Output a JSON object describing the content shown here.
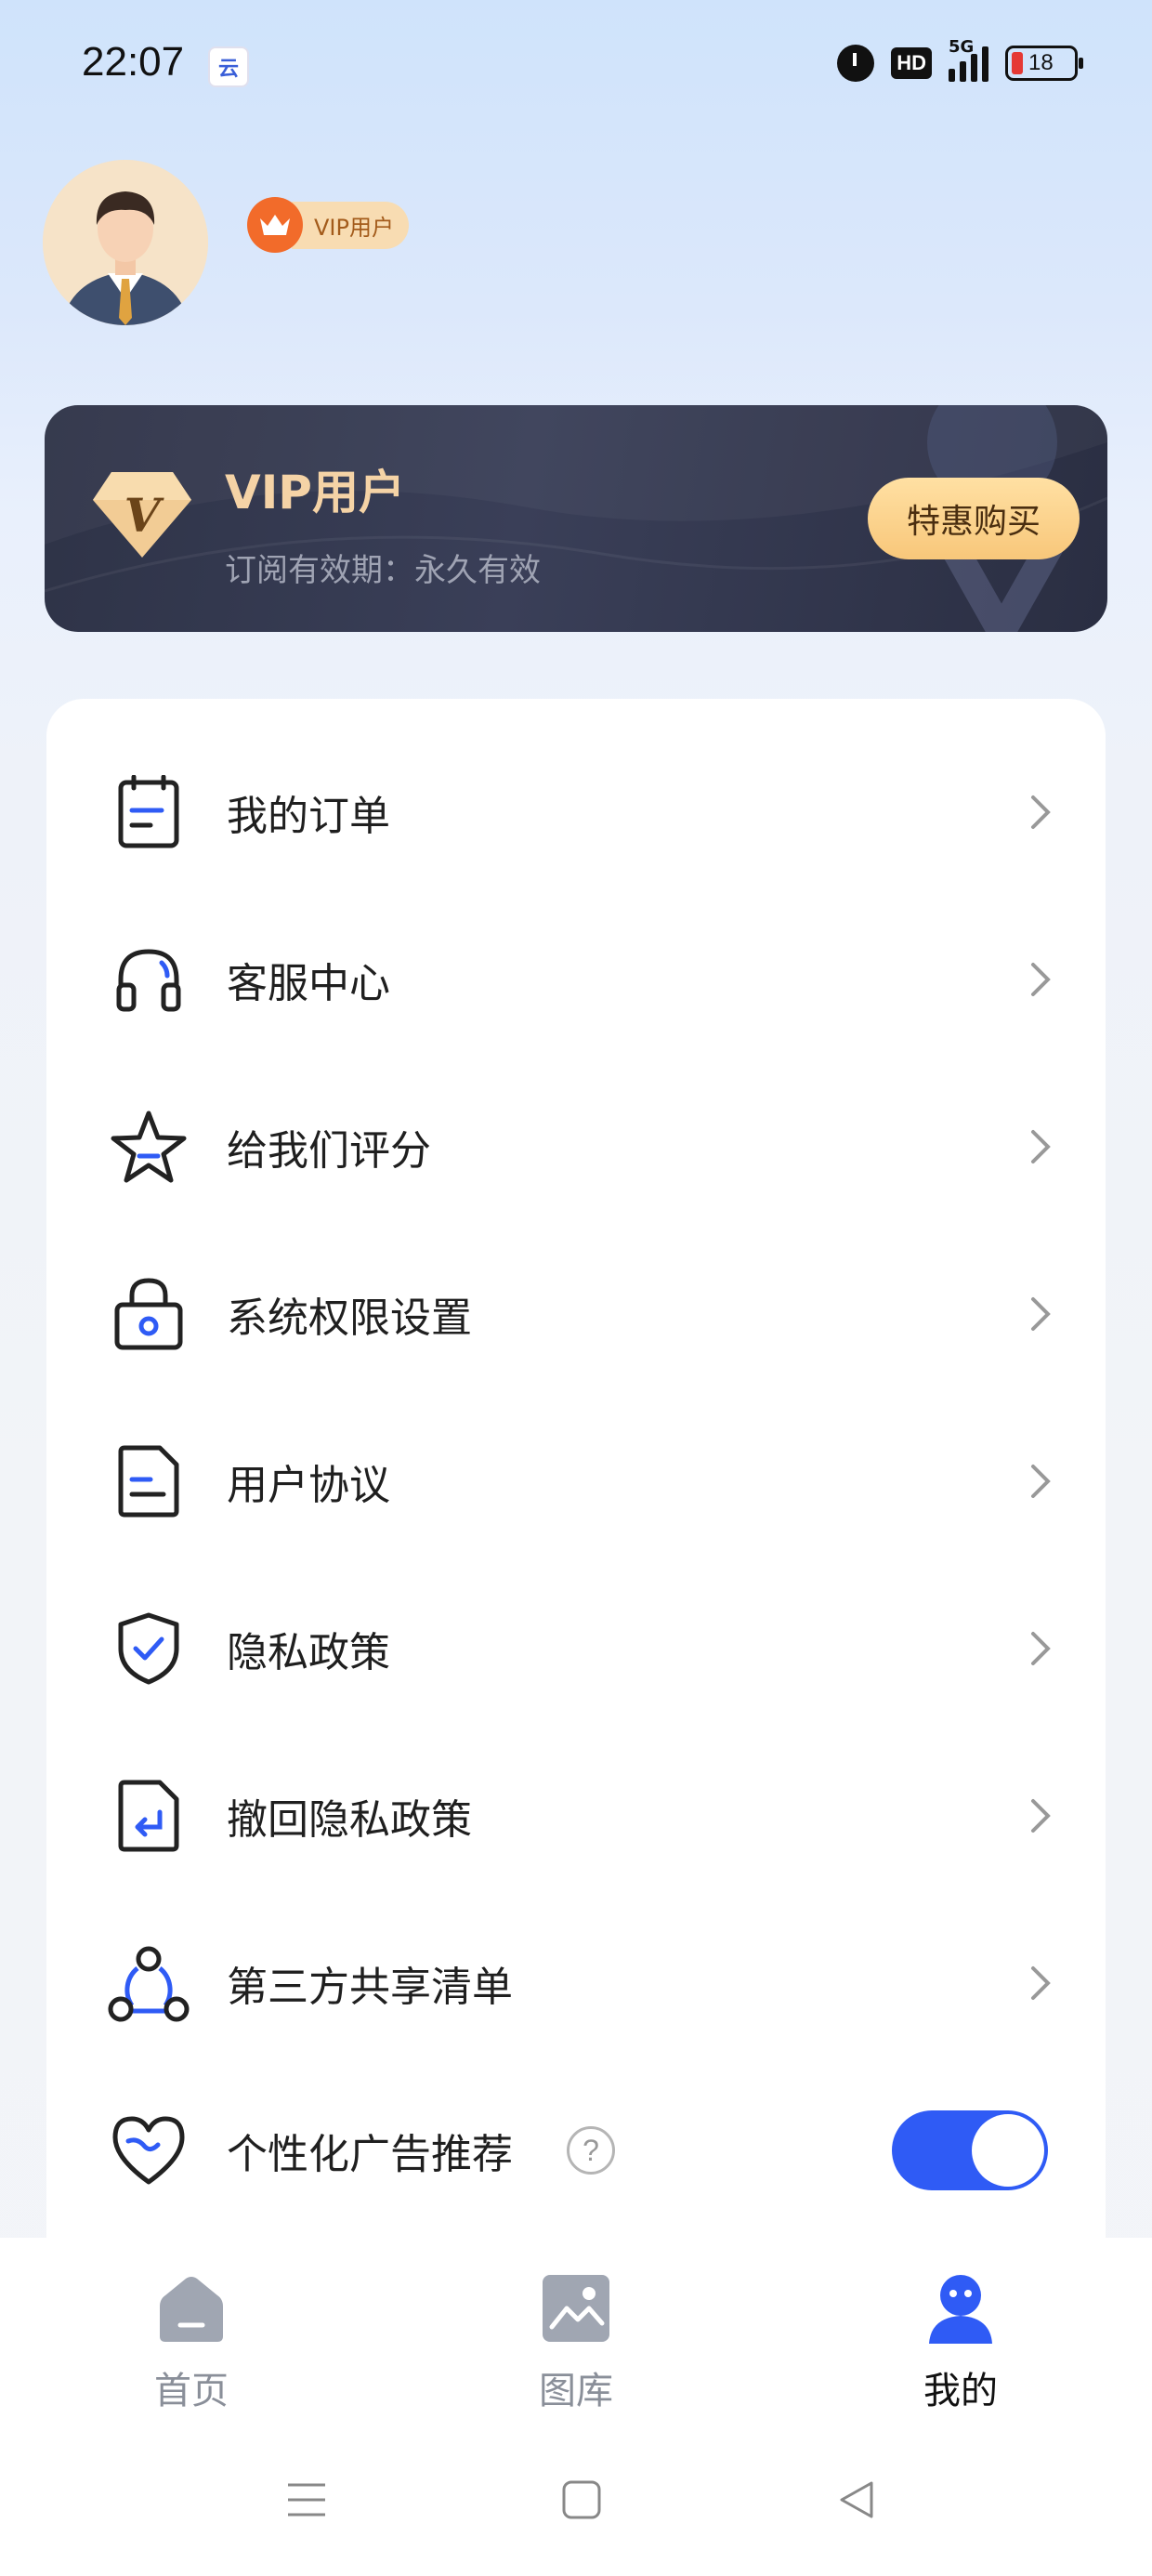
{
  "status_bar": {
    "time": "22:07",
    "app_icon_text": "云",
    "hd": "HD",
    "network": "5G",
    "battery": "18"
  },
  "profile": {
    "badge_label": "VIP用户"
  },
  "vip_card": {
    "title": "VIP用户",
    "subtitle": "订阅有效期：永久有效",
    "buy_label": "特惠购买"
  },
  "menu": {
    "items": [
      {
        "label": "我的订单",
        "icon": "order-icon"
      },
      {
        "label": "客服中心",
        "icon": "headset-icon"
      },
      {
        "label": "给我们评分",
        "icon": "star-icon"
      },
      {
        "label": "系统权限设置",
        "icon": "lock-icon"
      },
      {
        "label": "用户协议",
        "icon": "document-icon"
      },
      {
        "label": "隐私政策",
        "icon": "shield-check-icon"
      },
      {
        "label": "撤回隐私政策",
        "icon": "document-return-icon"
      },
      {
        "label": "第三方共享清单",
        "icon": "share-nodes-icon"
      },
      {
        "label": "个性化广告推荐",
        "icon": "heart-icon",
        "toggle": true,
        "help": "?"
      }
    ]
  },
  "bottom_nav": {
    "tabs": [
      {
        "label": "首页",
        "icon": "home-icon",
        "active": false
      },
      {
        "label": "图库",
        "icon": "gallery-icon",
        "active": false
      },
      {
        "label": "我的",
        "icon": "profile-icon",
        "active": true
      }
    ]
  },
  "colors": {
    "accent": "#2f5bf5",
    "vip_gold": "#f5d3a6",
    "card_dark": "#2e3347"
  }
}
